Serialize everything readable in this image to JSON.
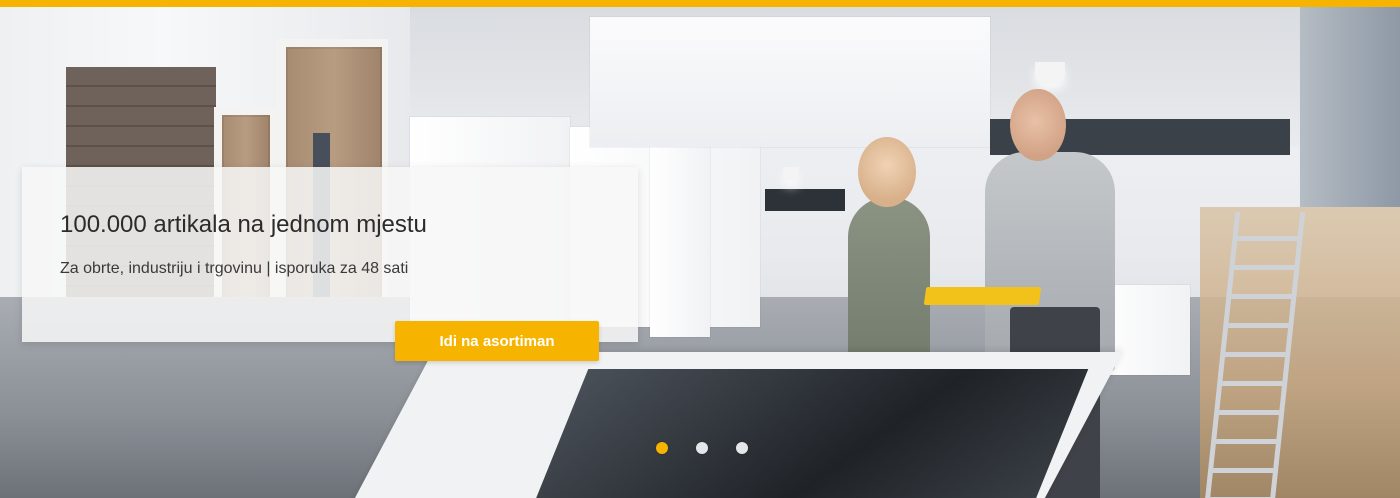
{
  "hero": {
    "title": "100.000 artikala na jednom mjestu",
    "subtitle": "Za obrte, industriju i trgovinu | isporuka za 48 sati",
    "cta_label": "Idi na asortiman",
    "slide_count": 3,
    "active_slide": 1
  },
  "colors": {
    "accent": "#f6b400",
    "card_bg": "#f7f7f7",
    "dot_inactive": "#e4e6e9"
  },
  "icons": {
    "carousel_dot": "dot"
  }
}
